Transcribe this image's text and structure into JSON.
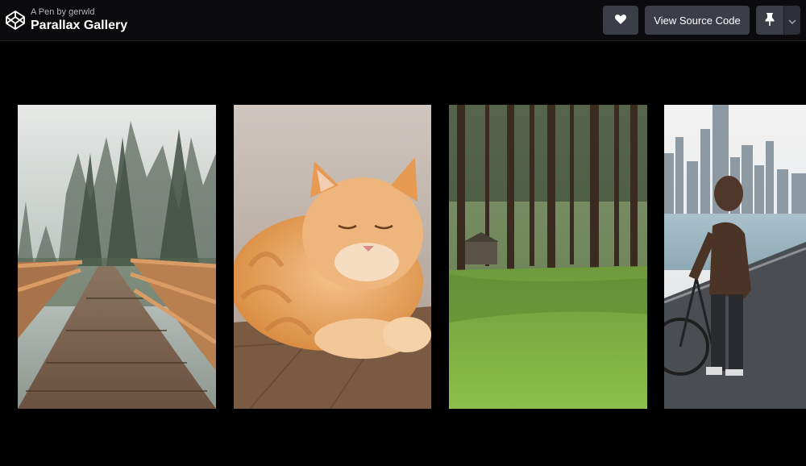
{
  "header": {
    "byline": "A Pen by gerwld",
    "title": "Parallax Gallery",
    "logo_icon": "codepen-cube-icon",
    "heart_icon": "heart-icon",
    "source_label": "View Source Code",
    "pin_icon": "pin-icon",
    "menu_icon": "chevron-down-icon"
  },
  "gallery": {
    "images": [
      {
        "subject": "wooden boardwalk through misty forest"
      },
      {
        "subject": "orange tabby cat sleeping"
      },
      {
        "subject": "sunlit pine forest with green grass"
      },
      {
        "subject": "person walking a bicycle beside a lake with city skyline"
      }
    ]
  },
  "colors": {
    "background": "#000000",
    "topbar": "#0b0b0d",
    "button": "#3b3e47"
  }
}
